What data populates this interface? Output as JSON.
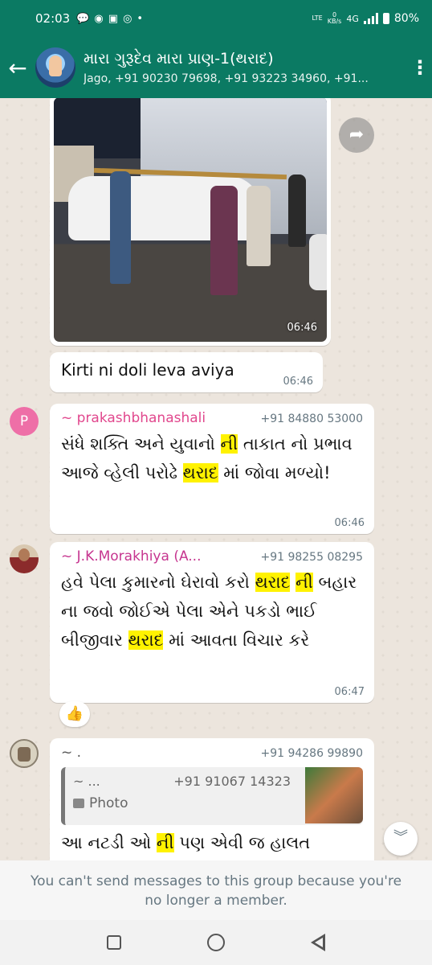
{
  "status_bar": {
    "time": "02:03",
    "volte": "LTE",
    "speed_value": "0",
    "speed_unit": "KB/s",
    "network": "4G",
    "battery": "80%"
  },
  "header": {
    "group_name": "મારા ગુરૂદેવ મારા પ્રાણ-1(થરાદ)",
    "members": "Jago, +91 90230 79698, +91 93223 34960, +91..."
  },
  "messages": {
    "image": {
      "time": "06:46"
    },
    "caption": {
      "text": "Kirti ni doli leva aviya",
      "time": "06:46"
    },
    "m1": {
      "avatar_letter": "P",
      "sender": "~ prakashbhanashali",
      "phone": "+91 84880 53000",
      "parts": [
        "સંધે શક્તિ અને યુવાનો ",
        "ની",
        " તાકાત નો પ્રભાવ આજે વ્હેલી પરોઢે ",
        "થરાદ",
        " માં જોવા મળ્યો!"
      ],
      "time": "06:46"
    },
    "m2": {
      "sender": "~ J.K.Morakhiya (A...",
      "phone": "+91 98255 08295",
      "parts": [
        "હવે પેલા કુમારનો ઘેરાવો કરો ",
        "થરાદ",
        " ",
        "ની",
        " બહાર ના જવો જોઈએ પેલા એને પકડો ભાઈ બીજીવાર ",
        "થરાદ",
        " માં આવતા વિચાર કરે"
      ],
      "time": "06:47",
      "reaction": "👍"
    },
    "m3": {
      "sender": "~ .",
      "phone": "+91 94286 99890",
      "quote": {
        "sender": "~ ...",
        "phone": "+91 91067 14323",
        "type": "Photo"
      },
      "parts": [
        "આ નટડી ઓ ",
        "ની",
        " પણ એવી જ હાલત"
      ]
    }
  },
  "notice": {
    "line1": "You can't send messages to this group because you're",
    "line2": "no longer a member."
  },
  "colors": {
    "header": "#0b7a63",
    "highlight": "#fff200",
    "chat_bg": "#ece5dd"
  },
  "icons": [
    "back-arrow-icon",
    "more-vert-icon",
    "forward-icon",
    "scroll-down-icon",
    "recents-icon",
    "home-icon",
    "nav-back-icon"
  ]
}
